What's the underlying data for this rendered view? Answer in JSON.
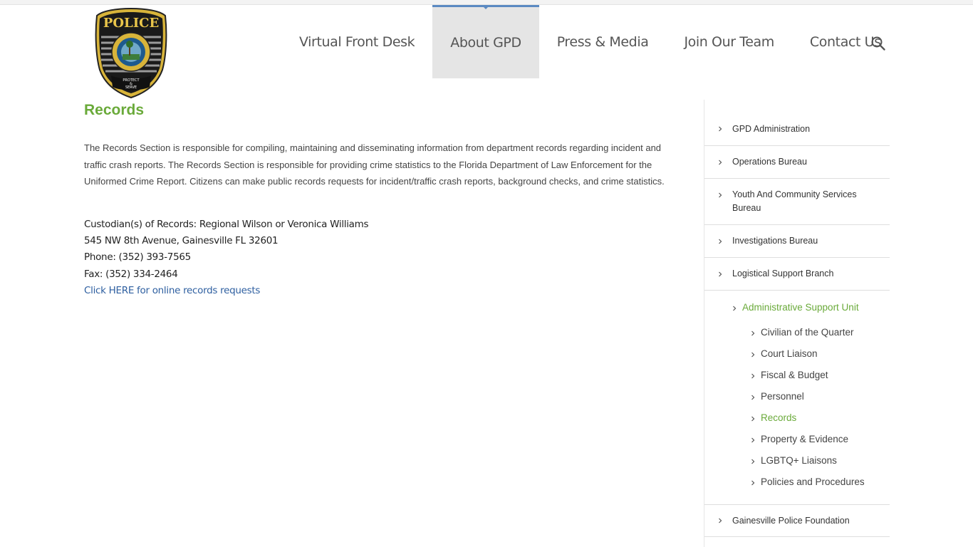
{
  "logo": {
    "top_text": "POLICE",
    "ring_top": "CITY OF GAINESVILLE",
    "ring_bottom": "STATE OF FLORIDA",
    "motto_1": "PROTECT",
    "motto_2": "&",
    "motto_3": "SERVE"
  },
  "nav": {
    "items": [
      {
        "label": "Virtual Front Desk"
      },
      {
        "label": "About GPD"
      },
      {
        "label": "Press & Media"
      },
      {
        "label": "Join Our Team"
      },
      {
        "label": "Contact Us"
      }
    ],
    "active": "About GPD"
  },
  "content": {
    "title": "Records",
    "intro": "The Records Section is responsible for compiling, maintaining and disseminating information from department records regarding incident and traffic crash reports.  The Records Section is responsible for providing crime statistics to the Florida Department of Law Enforcement for the Uniformed Crime Report.  Citizens can make public records requests for incident/traffic crash reports, background checks, and crime statistics.",
    "custodian": "Custodian(s) of Records: Regional Wilson or Veronica Williams",
    "address": "545 NW 8th Avenue, Gainesville FL  32601",
    "phone": "Phone: (352) 393-7565",
    "fax": "Fax: (352) 334-2464",
    "link": "Click HERE for online records requests"
  },
  "sidebar": {
    "items": [
      {
        "label": "GPD Administration"
      },
      {
        "label": "Operations Bureau"
      },
      {
        "label": "Youth And Community Services Bureau"
      },
      {
        "label": "Investigations Bureau"
      },
      {
        "label": "Logistical Support Branch"
      },
      {
        "label": "Gainesville Police Foundation"
      }
    ],
    "sub_section": "Administrative Support Unit",
    "sub_items": [
      {
        "label": "Civilian of the Quarter"
      },
      {
        "label": "Court Liaison"
      },
      {
        "label": "Fiscal & Budget"
      },
      {
        "label": "Personnel"
      },
      {
        "label": "Records"
      },
      {
        "label": "Property & Evidence"
      },
      {
        "label": "LGBTQ+ Liaisons"
      },
      {
        "label": "Policies and Procedures"
      }
    ],
    "active_sub": "Records"
  },
  "colors": {
    "accent_green": "#6aaa3a",
    "nav_active_bar": "#5b8ac2",
    "link_blue": "#2e5fa0"
  }
}
